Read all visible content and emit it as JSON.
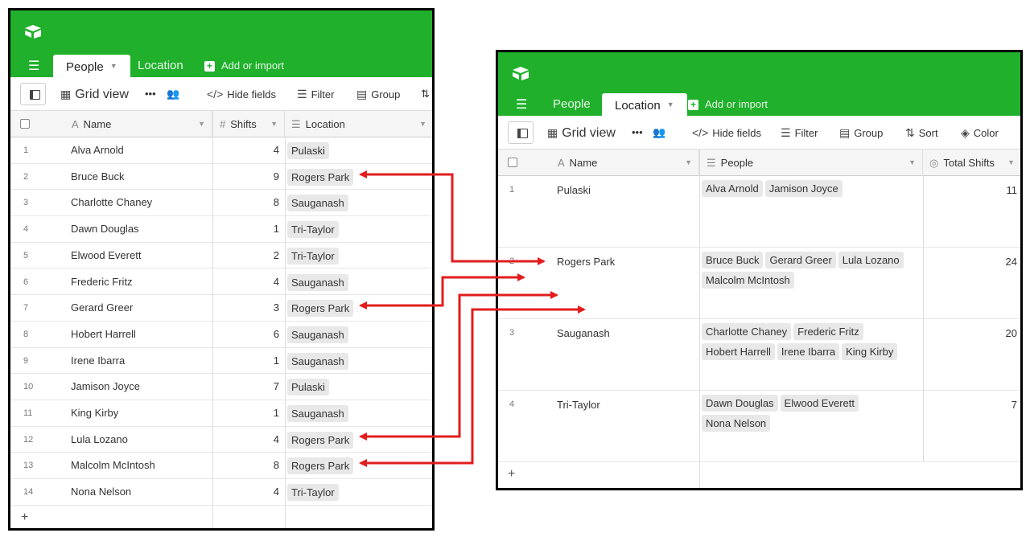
{
  "colors": {
    "brand": "#20b02c",
    "arrow": "#e21d1d",
    "pill": "#e8e8e8"
  },
  "left": {
    "logo": "airtable-logo-icon",
    "tabs": [
      {
        "label": "People",
        "active": true
      },
      {
        "label": "Location",
        "active": false
      }
    ],
    "add_import": "Add or import",
    "toolbar": {
      "view_name": "Grid view",
      "hide_fields": "Hide fields",
      "filter": "Filter",
      "group": "Group"
    },
    "columns": {
      "name": "Name",
      "shifts": "Shifts",
      "location": "Location"
    },
    "rows": [
      {
        "num": "1",
        "name": "Alva Arnold",
        "shifts": "4",
        "location": "Pulaski"
      },
      {
        "num": "2",
        "name": "Bruce Buck",
        "shifts": "9",
        "location": "Rogers Park"
      },
      {
        "num": "3",
        "name": "Charlotte Chaney",
        "shifts": "8",
        "location": "Sauganash"
      },
      {
        "num": "4",
        "name": "Dawn Douglas",
        "shifts": "1",
        "location": "Tri-Taylor"
      },
      {
        "num": "5",
        "name": "Elwood Everett",
        "shifts": "2",
        "location": "Tri-Taylor"
      },
      {
        "num": "6",
        "name": "Frederic Fritz",
        "shifts": "4",
        "location": "Sauganash"
      },
      {
        "num": "7",
        "name": "Gerard Greer",
        "shifts": "3",
        "location": "Rogers Park"
      },
      {
        "num": "8",
        "name": "Hobert Harrell",
        "shifts": "6",
        "location": "Sauganash"
      },
      {
        "num": "9",
        "name": "Irene Ibarra",
        "shifts": "1",
        "location": "Sauganash"
      },
      {
        "num": "10",
        "name": "Jamison Joyce",
        "shifts": "7",
        "location": "Pulaski"
      },
      {
        "num": "11",
        "name": "King Kirby",
        "shifts": "1",
        "location": "Sauganash"
      },
      {
        "num": "12",
        "name": "Lula Lozano",
        "shifts": "4",
        "location": "Rogers Park"
      },
      {
        "num": "13",
        "name": "Malcolm McIntosh",
        "shifts": "8",
        "location": "Rogers Park"
      },
      {
        "num": "14",
        "name": "Nona Nelson",
        "shifts": "4",
        "location": "Tri-Taylor"
      }
    ],
    "add_row": "+"
  },
  "right": {
    "logo": "airtable-logo-icon",
    "tabs": [
      {
        "label": "People",
        "active": false
      },
      {
        "label": "Location",
        "active": true
      }
    ],
    "add_import": "Add or import",
    "toolbar": {
      "view_name": "Grid view",
      "hide_fields": "Hide fields",
      "filter": "Filter",
      "group": "Group",
      "sort": "Sort",
      "color": "Color"
    },
    "columns": {
      "name": "Name",
      "people": "People",
      "total_shifts": "Total Shifts"
    },
    "rows": [
      {
        "num": "1",
        "name": "Pulaski",
        "people": [
          "Alva Arnold",
          "Jamison Joyce"
        ],
        "total": "11"
      },
      {
        "num": "2",
        "name": "Rogers Park",
        "people": [
          "Bruce Buck",
          "Gerard Greer",
          "Lula Lozano",
          "Malcolm McIntosh"
        ],
        "total": "24"
      },
      {
        "num": "3",
        "name": "Sauganash",
        "people": [
          "Charlotte Chaney",
          "Frederic Fritz",
          "Hobert Harrell",
          "Irene Ibarra",
          "King Kirby"
        ],
        "total": "20"
      },
      {
        "num": "4",
        "name": "Tri-Taylor",
        "people": [
          "Dawn Douglas",
          "Elwood Everett",
          "Nona Nelson"
        ],
        "total": "7"
      }
    ],
    "add_row": "+"
  }
}
